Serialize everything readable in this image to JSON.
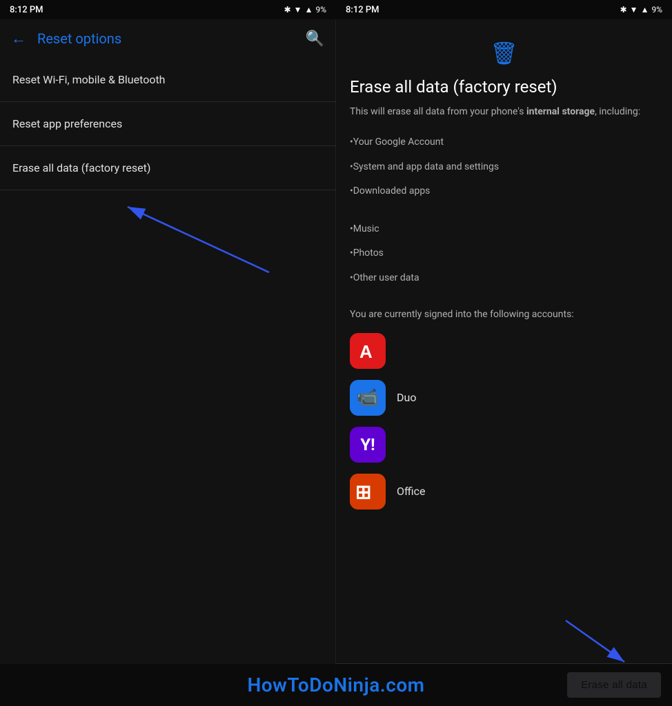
{
  "left": {
    "statusBar": {
      "time": "8:12 PM",
      "batteryPercent": "9%"
    },
    "header": {
      "backLabel": "←",
      "title": "Reset options",
      "searchLabel": "🔍"
    },
    "menuItems": [
      {
        "label": "Reset Wi-Fi, mobile & Bluetooth"
      },
      {
        "label": "Reset app preferences"
      },
      {
        "label": "Erase all data (factory reset)"
      }
    ]
  },
  "right": {
    "statusBar": {
      "time": "8:12 PM",
      "batteryPercent": "9%"
    },
    "trashIcon": "🗑",
    "title": "Erase all data (factory reset)",
    "description": "This will erase all data from your phone's ",
    "descriptionBold": "internal storage",
    "descriptionEnd": ", including:",
    "listItems": [
      "•Your Google Account",
      "•System and app data and settings",
      "•Downloaded apps",
      "•Music",
      "•Photos",
      "•Other user data"
    ],
    "accountsText": "You are currently signed into the following accounts:",
    "apps": [
      {
        "name": "",
        "iconType": "adobe"
      },
      {
        "name": "Duo",
        "iconType": "duo"
      },
      {
        "name": "",
        "iconType": "yahoo"
      },
      {
        "name": "Office",
        "iconType": "office"
      }
    ],
    "eraseButtonLabel": "Erase all data"
  },
  "watermark": {
    "text": "HowToDoNinja.com"
  }
}
